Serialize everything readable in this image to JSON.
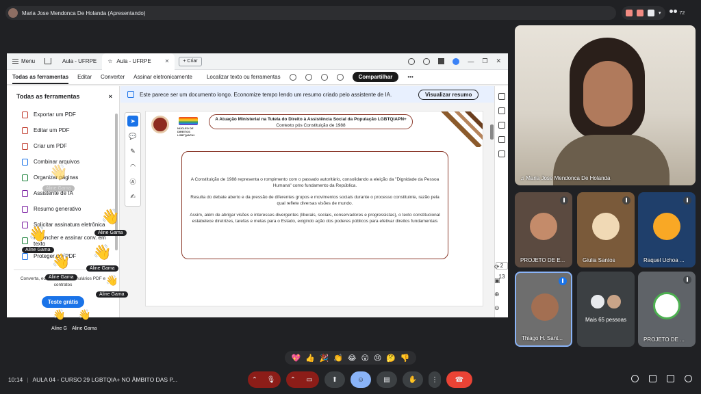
{
  "presenter": {
    "name": "Maria Jose Mendonca De Holanda (Apresentando)"
  },
  "participant_count": "72",
  "browser": {
    "menu_label": "Menu",
    "tabs": [
      {
        "label": "Aula - UFRPE",
        "active": false
      },
      {
        "label": "Aula - UFRPE",
        "active": true
      }
    ],
    "new_tab_label": "+ Criar"
  },
  "acrobat": {
    "toolbar": [
      "Todas as ferramentas",
      "Editar",
      "Converter",
      "Assinar eletronicamente"
    ],
    "search_label": "Localizar texto ou ferramentas",
    "share_label": "Compartilhar",
    "more_label": "•••"
  },
  "tools_panel": {
    "title": "Todas as ferramentas",
    "close": "×",
    "items": [
      "Exportar um PDF",
      "Editar um PDF",
      "Criar um PDF",
      "Combinar arquivos",
      "Organizar páginas",
      "Assistente de IA",
      "Resumo generativo",
      "Solicitar assinatura eletrônica",
      "Preencher e assinar conv. em texto",
      "Proteger um PDF"
    ],
    "note": "Converta, edite e assine formulários PDF e contratos",
    "trial_button": "Teste grátis"
  },
  "banner": {
    "text": "Este parece ser um documento longo. Economize tempo lendo um resumo criado pelo assistente de IA.",
    "button": "Visualizar resumo",
    "close": "×"
  },
  "document": {
    "logo_text": "NÚCLEO DE DIREITOS LGBTQIAPN+",
    "title": "A Atuação Ministerial na Tutela do Direito à Assistência Social da População LGBTQIAPN+",
    "subtitle": "Contexto pós Constituição de 1988",
    "paragraphs": [
      "A Constituição de 1988 representa o rompimento com o passado autoritário, consolidando a eleição da \"Dignidade da Pessoa Humana\" como fundamento da República.",
      "Resulta do debate aberto e da pressão de diferentes grupos e movimentos sociais durante o processo constituinte, razão pela qual reflete diversas visões de mundo.",
      "Assim, além de abrigar visões e interesses divergentes (liberais, sociais, conservadores e progressistas), o texto constitucional estabelece diretrizes, tarefas e metas para o Estado, exigindo ação dos poderes públicos para efetivar direitos fundamentais"
    ],
    "current_page": "2",
    "total_pages": "13"
  },
  "reactions": [
    {
      "label": "Aline Gama"
    },
    {
      "label": "Aline Gama"
    },
    {
      "label": "Aline Gama"
    },
    {
      "label": "Aline Gama"
    },
    {
      "label": "Aline Gama"
    },
    {
      "label": "Aline Gama"
    },
    {
      "label": "Aline Gama"
    },
    {
      "label": "Aline G"
    },
    {
      "label": "Aline Gama"
    }
  ],
  "participants": {
    "main": "Maria Jose Mendonca De Holanda",
    "tiles": [
      {
        "name": "PROJETO DE E..."
      },
      {
        "name": "Giulia Santos"
      },
      {
        "name": "Raquel Uchoa ..."
      },
      {
        "name": "Thiago H. Sant..."
      },
      {
        "name": "Mais 65 pessoas"
      },
      {
        "name": "PROJETO DE ..."
      }
    ]
  },
  "reaction_bar": [
    "💖",
    "👍",
    "🎉",
    "👏",
    "😂",
    "😮",
    "😢",
    "🤔",
    "👎"
  ],
  "meeting": {
    "time": "10:14",
    "title": "AULA 04 - CURSO 29 LGBTQIA+ NO ÂMBITO DAS P..."
  }
}
